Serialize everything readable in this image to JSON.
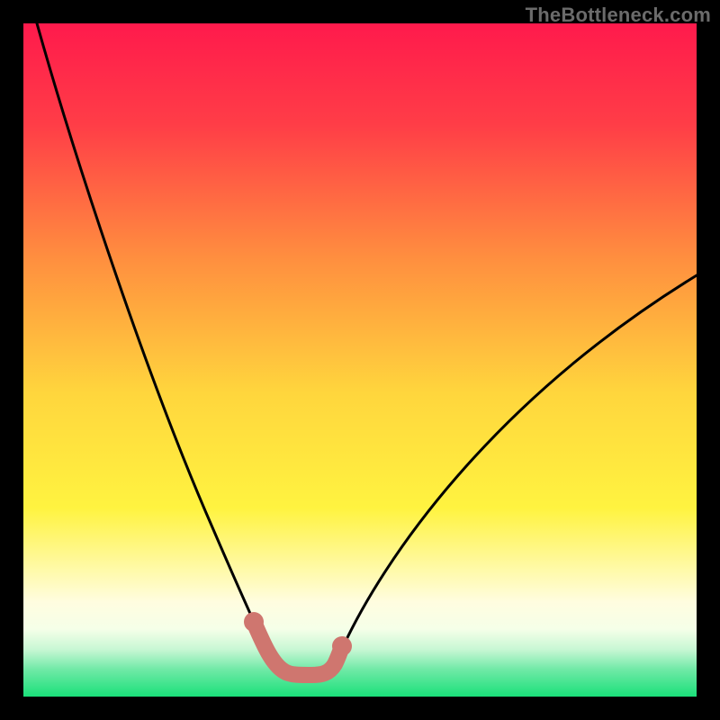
{
  "watermark": "TheBottleneck.com",
  "chart_data": {
    "type": "line",
    "title": "",
    "xlabel": "",
    "ylabel": "",
    "xlim": [
      0,
      100
    ],
    "ylim": [
      0,
      100
    ],
    "grid": false,
    "series": [
      {
        "name": "bottleneck-curve",
        "x": [
          2,
          5,
          10,
          15,
          20,
          25,
          28,
          30,
          32,
          34,
          36,
          37,
          38,
          40,
          42,
          44,
          46,
          50,
          55,
          60,
          65,
          70,
          75,
          80,
          85,
          90,
          95,
          100
        ],
        "y": [
          100,
          92,
          80,
          68,
          56,
          43,
          34,
          27,
          20,
          14,
          8,
          5,
          3,
          3,
          3,
          3,
          5,
          10,
          18,
          26,
          33,
          40,
          46,
          51,
          55,
          58,
          60,
          62
        ],
        "color": "#000000"
      }
    ],
    "highlight_segment": {
      "name": "optimal-zone",
      "x": [
        34,
        35,
        36,
        37,
        38,
        40,
        42,
        44,
        45,
        46
      ],
      "y": [
        14,
        11,
        8,
        5,
        3,
        3,
        3,
        3,
        4,
        5
      ],
      "color": "#cf766f"
    },
    "background_gradient": {
      "top": "#ff1a4c",
      "mid_upper": "#ffb23d",
      "mid": "#fff340",
      "mid_lower": "#fffde0",
      "bottom": "#1ae07a"
    }
  }
}
